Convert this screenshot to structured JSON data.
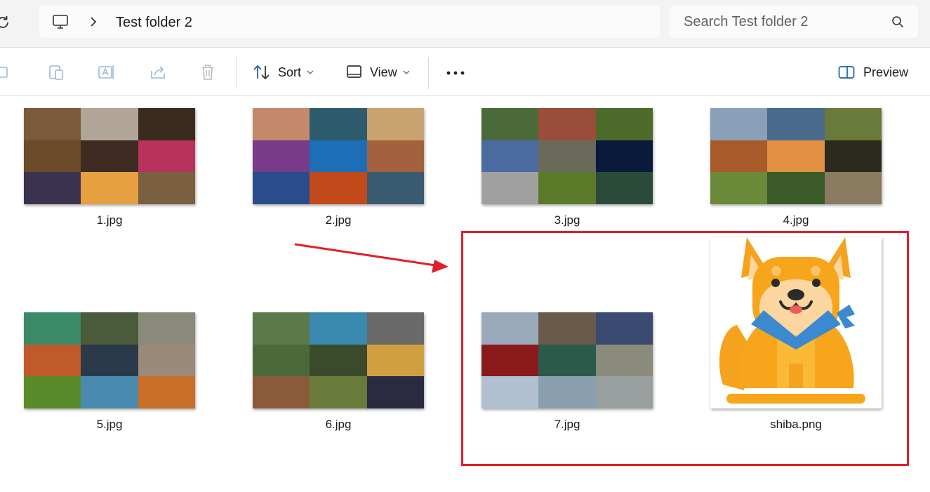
{
  "addressbar": {
    "crumb": "Test folder 2"
  },
  "search": {
    "placeholder": "Search Test folder 2"
  },
  "toolbar": {
    "sort_label": "Sort",
    "view_label": "View",
    "preview_label": "Preview"
  },
  "files": [
    {
      "name": "1.jpg",
      "colors": [
        "#7a5a3a",
        "#b0a596",
        "#3b2a1e",
        "#6b4a2a",
        "#3e2a20",
        "#b8325e",
        "#3b3250",
        "#e6a040",
        "#7a6040"
      ]
    },
    {
      "name": "2.jpg",
      "colors": [
        "#c28a6a",
        "#2e5a6e",
        "#c9a370",
        "#7a3a8a",
        "#1c6fb6",
        "#a2623e",
        "#2a4b8c",
        "#c24a1a",
        "#3a5a70"
      ]
    },
    {
      "name": "3.jpg",
      "colors": [
        "#4a6a3a",
        "#9a4e3a",
        "#4c6a2a",
        "#4a6aa0",
        "#6a6a5a",
        "#0a1a3a",
        "#a0a0a0",
        "#5a7a2a",
        "#2a4a3a"
      ]
    },
    {
      "name": "4.jpg",
      "colors": [
        "#8aa0b8",
        "#4a6a8c",
        "#6a7a3a",
        "#a85a2a",
        "#e09040",
        "#2a2a1e",
        "#6a8a3a",
        "#3a5a2a",
        "#8a7a60"
      ]
    },
    {
      "name": "5.jpg",
      "colors": [
        "#3a8a6a",
        "#4a5a3a",
        "#8a8a7a",
        "#c05a2a",
        "#2a3a4a",
        "#9a8a7a",
        "#5a8a2a",
        "#4a8ab0",
        "#c8702a"
      ]
    },
    {
      "name": "6.jpg",
      "colors": [
        "#5a7a4a",
        "#3a8ab0",
        "#6a6a6a",
        "#4a6a3a",
        "#3a4a2a",
        "#d0a040",
        "#8a5a3a",
        "#6a7a3a",
        "#2a2a40"
      ]
    },
    {
      "name": "7.jpg",
      "colors": [
        "#9aaabb",
        "#6a5a4a",
        "#3a4a70",
        "#8a1a1a",
        "#2a5a4a",
        "#8a8a7a",
        "#b0c0d0",
        "#8aa0b0",
        "#9aa0a0"
      ]
    },
    {
      "name": "shiba.png"
    }
  ],
  "icons": [
    "refresh-icon",
    "computer-icon",
    "chevron-right-icon",
    "search-icon",
    "copy-icon",
    "paste-icon",
    "rename-icon",
    "share-icon",
    "delete-icon",
    "sort-icon",
    "view-icon",
    "more-icon",
    "preview-icon"
  ],
  "colors": {
    "highlight": "#e0202a",
    "toolbar_bg": "#f3f3f3"
  }
}
